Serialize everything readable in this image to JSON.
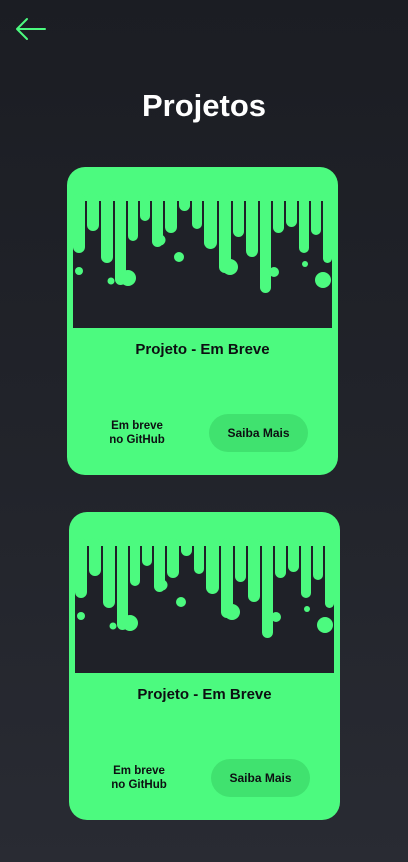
{
  "header": {
    "back_icon": "arrow-left-icon",
    "title": "Projetos"
  },
  "colors": {
    "accent": "#4cfa7f",
    "background": "#1f2128",
    "button": "#40e26f"
  },
  "projects": [
    {
      "title": "Projeto - Em Breve",
      "status_line1": "Em breve",
      "status_line2": "no GitHub",
      "button_label": "Saiba Mais",
      "image": "slime-drip-illustration"
    },
    {
      "title": "Projeto - Em Breve",
      "status_line1": "Em breve",
      "status_line2": "no GitHub",
      "button_label": "Saiba Mais",
      "image": "slime-drip-illustration"
    }
  ]
}
